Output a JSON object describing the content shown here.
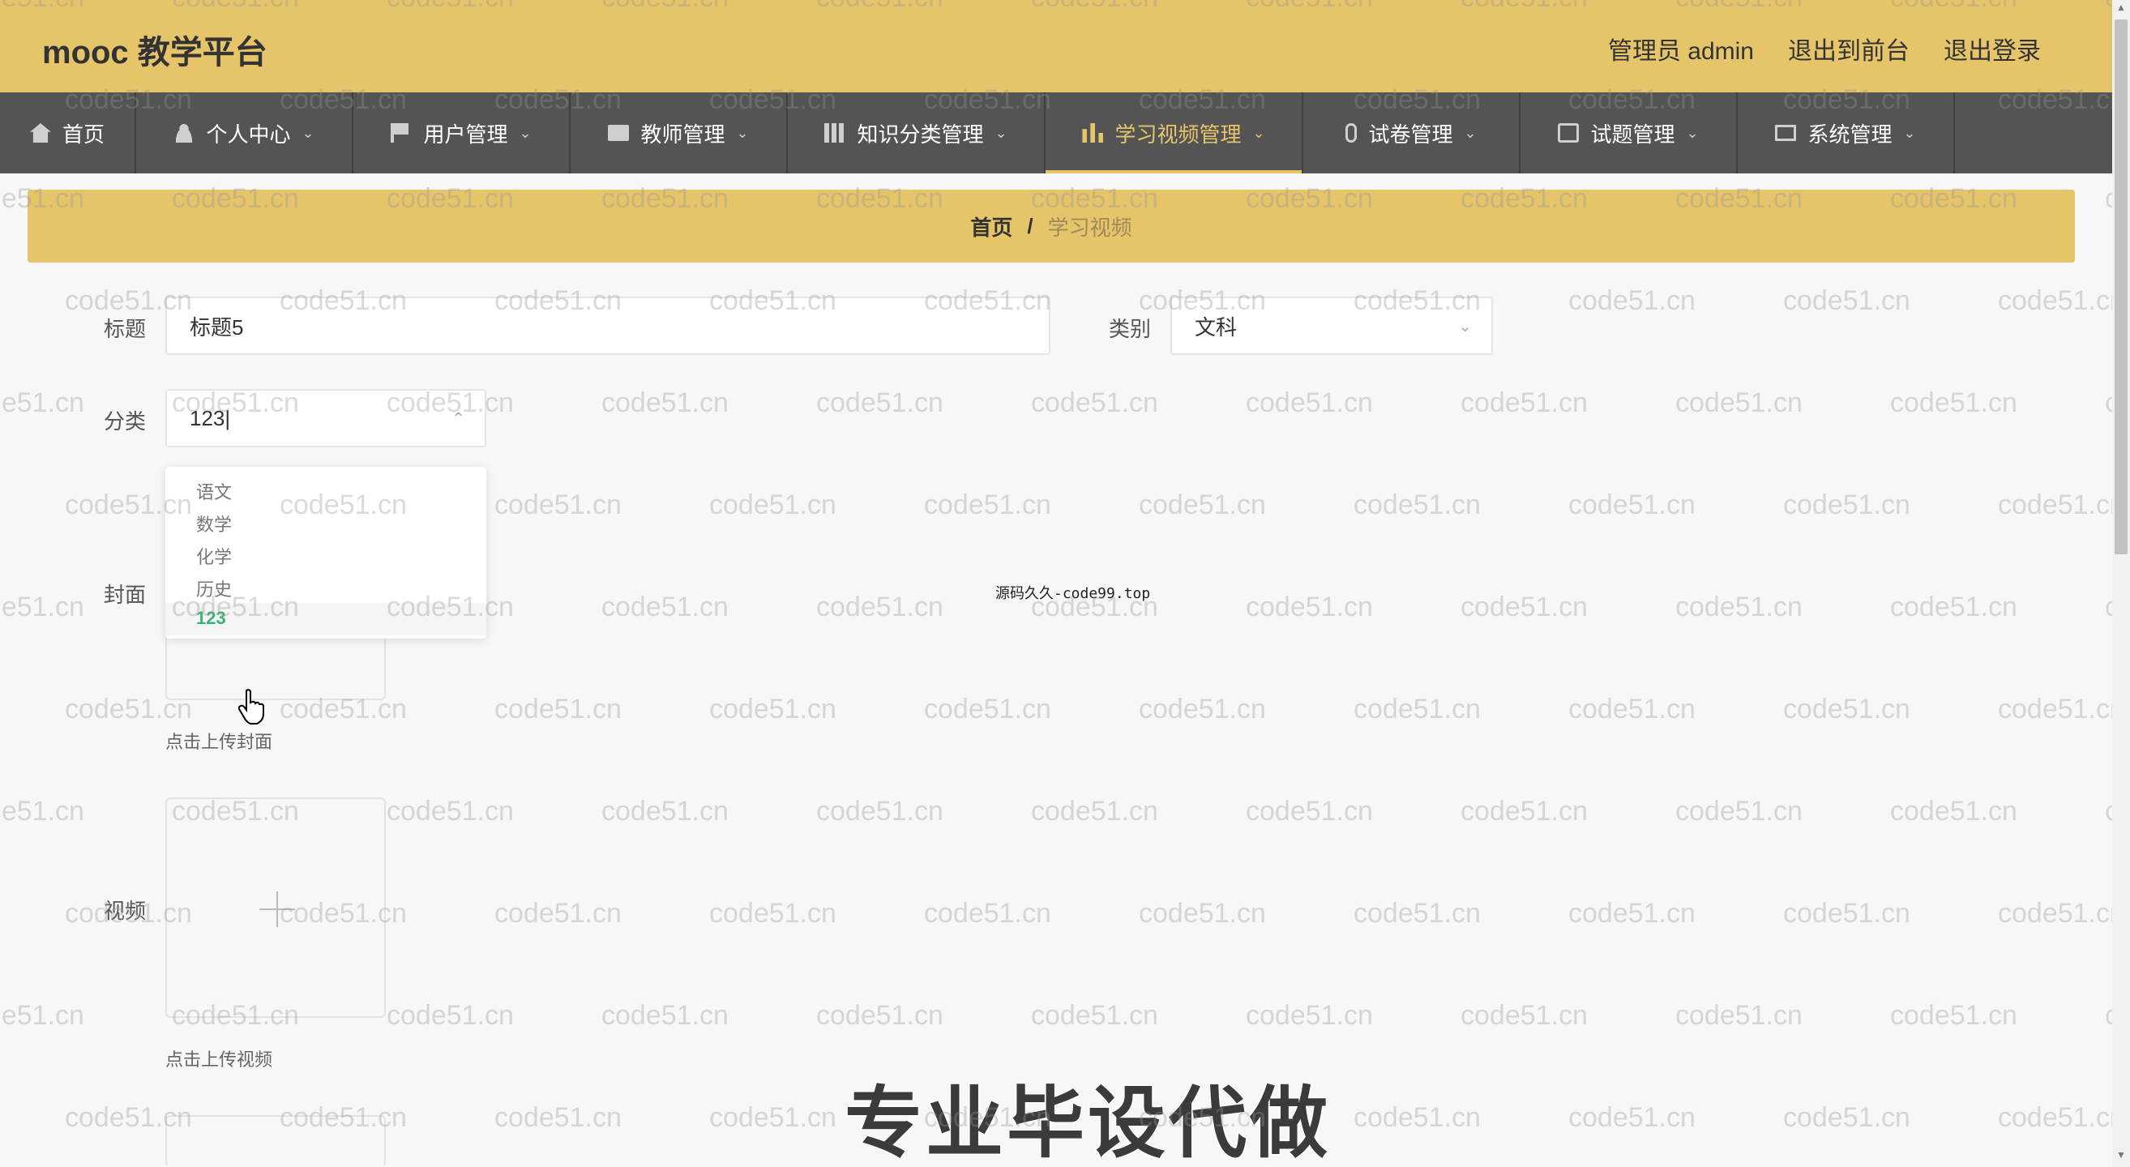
{
  "header": {
    "brand": "mooc 教学平台",
    "admin_label": "管理员 admin",
    "back_to_front": "退出到前台",
    "logout": "退出登录"
  },
  "nav": [
    {
      "label": "首页",
      "icon": "home-icon"
    },
    {
      "label": "个人中心",
      "icon": "person-icon"
    },
    {
      "label": "用户管理",
      "icon": "flag-icon"
    },
    {
      "label": "教师管理",
      "icon": "book-icon"
    },
    {
      "label": "知识分类管理",
      "icon": "books-icon"
    },
    {
      "label": "学习视频管理",
      "icon": "bar-chart-icon",
      "active": true
    },
    {
      "label": "试卷管理",
      "icon": "microphone-icon"
    },
    {
      "label": "试题管理",
      "icon": "copy-icon"
    },
    {
      "label": "系统管理",
      "icon": "screen-icon"
    }
  ],
  "breadcrumb": {
    "home": "首页",
    "separator": "/",
    "current": "学习视频"
  },
  "form": {
    "title_label": "标题",
    "title_value": "标题5",
    "type_label": "类别",
    "type_value": "文科",
    "category_label": "分类",
    "category_value": "123",
    "category_options": [
      "语文",
      "数学",
      "化学",
      "历史",
      "123"
    ],
    "category_selected": "123",
    "cover_label": "封面",
    "cover_hint": "点击上传封面",
    "video_label": "视频",
    "video_hint": "点击上传视频"
  },
  "overlay": {
    "watermark": "code51.cn",
    "center_note": "源码久久-code99.top",
    "banner": "专业毕设代做"
  },
  "colors": {
    "accent": "#e6c46a",
    "nav_bg": "#545454",
    "selected_option": "#3db37a"
  }
}
